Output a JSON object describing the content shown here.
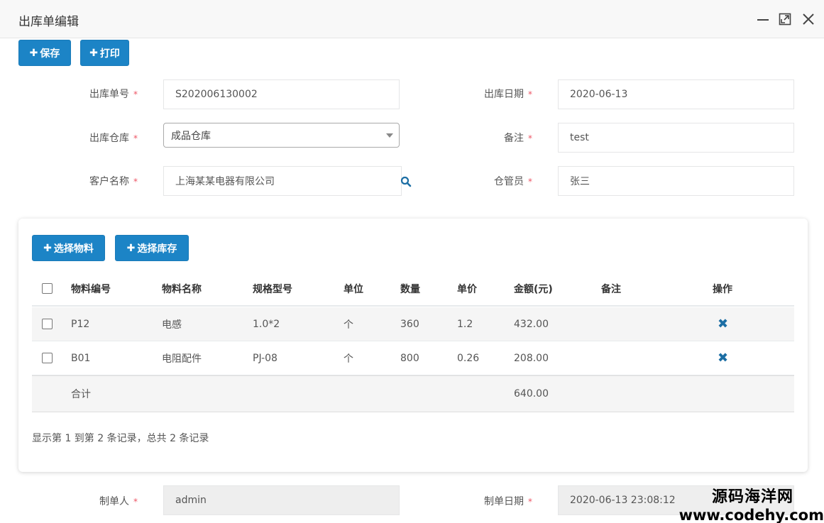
{
  "window": {
    "title": "出库单编辑"
  },
  "toolbar": {
    "save_label": "保存",
    "print_label": "打印"
  },
  "form": {
    "order_no": {
      "label": "出库单号",
      "value": "S202006130002"
    },
    "date": {
      "label": "出库日期",
      "value": "2020-06-13"
    },
    "warehouse": {
      "label": "出库仓库",
      "value": "成品仓库"
    },
    "remark": {
      "label": "备注",
      "value": "test"
    },
    "customer": {
      "label": "客户名称",
      "value": "上海某某电器有限公司"
    },
    "keeper": {
      "label": "仓管员",
      "value": "张三"
    },
    "creator": {
      "label": "制单人",
      "value": "admin"
    },
    "created_at": {
      "label": "制单日期",
      "value": "2020-06-13 23:08:12"
    }
  },
  "detail": {
    "select_material_label": "选择物料",
    "select_stock_label": "选择库存",
    "columns": [
      "物料编号",
      "物料名称",
      "规格型号",
      "单位",
      "数量",
      "单价",
      "金额(元)",
      "备注",
      "操作"
    ],
    "rows": [
      {
        "code": "P12",
        "name": "电感",
        "spec": "1.0*2",
        "unit": "个",
        "qty": "360",
        "price": "1.2",
        "amount": "432.00",
        "remark": ""
      },
      {
        "code": "B01",
        "name": "电阻配件",
        "spec": "PJ-08",
        "unit": "个",
        "qty": "800",
        "price": "0.26",
        "amount": "208.00",
        "remark": ""
      }
    ],
    "total_label": "合计",
    "total_amount": "640.00",
    "pager_text": "显示第 1 到第 2 条记录，总共 2 条记录"
  },
  "watermark": {
    "line1": "源码海洋网",
    "line2": "www.codehy.com"
  },
  "colors": {
    "primary": "#1c84c6",
    "required": "#ed5565",
    "delete": "#1c6ea4"
  },
  "icons": {
    "add": "plus-icon",
    "search": "search-icon",
    "delete": "close-icon"
  }
}
